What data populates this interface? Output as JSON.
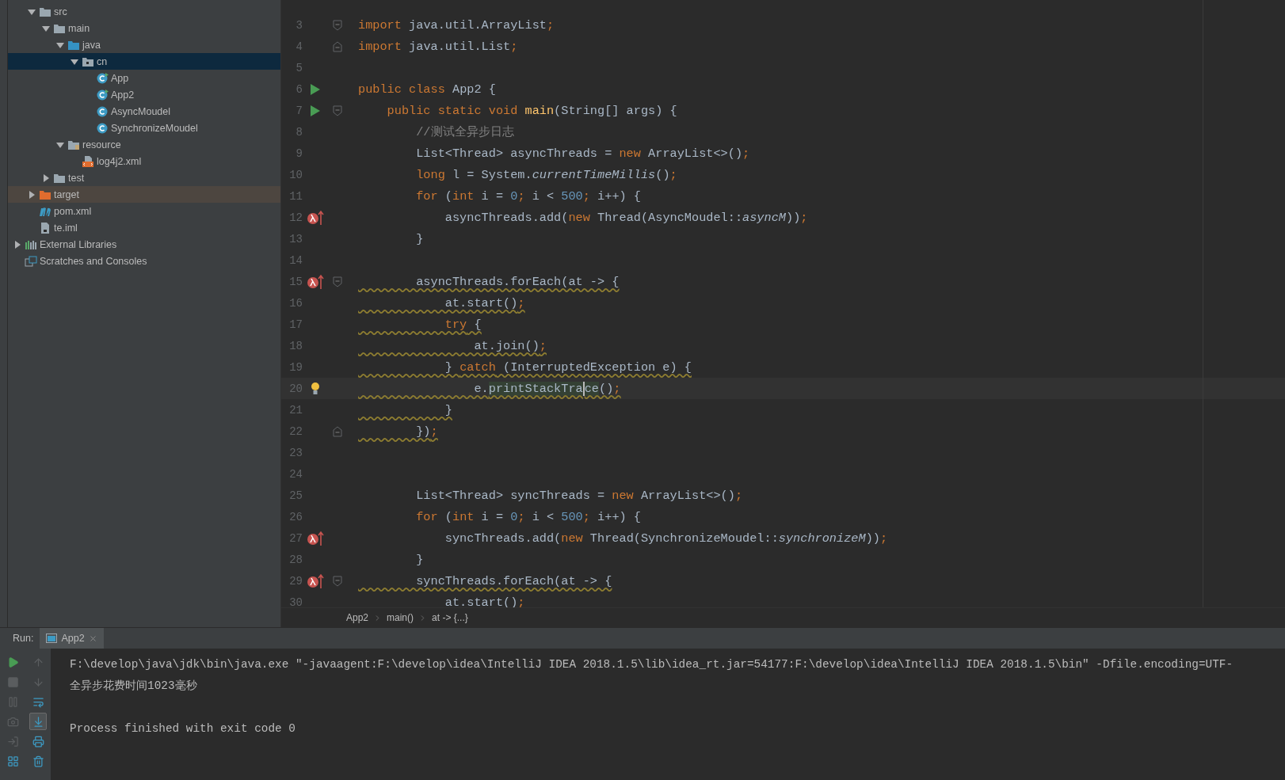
{
  "project_tree": {
    "items": [
      {
        "label": "src",
        "kind": "folder",
        "expanded": true,
        "selected": false,
        "children": [
          {
            "label": "main",
            "kind": "folder",
            "expanded": true,
            "selected": false,
            "children": [
              {
                "label": "java",
                "kind": "source-folder",
                "expanded": true,
                "selected": false,
                "children": [
                  {
                    "label": "cn",
                    "kind": "package",
                    "expanded": true,
                    "selected": true,
                    "children": [
                      {
                        "label": "App",
                        "kind": "run-class",
                        "selected": false
                      },
                      {
                        "label": "App2",
                        "kind": "run-class",
                        "selected": false
                      },
                      {
                        "label": "AsyncMoudel",
                        "kind": "class",
                        "selected": false
                      },
                      {
                        "label": "SynchronizeMoudel",
                        "kind": "class",
                        "selected": false
                      }
                    ]
                  }
                ]
              },
              {
                "label": "resource",
                "kind": "resource-folder",
                "expanded": true,
                "selected": false,
                "children": [
                  {
                    "label": "log4j2.xml",
                    "kind": "xml",
                    "selected": false
                  }
                ]
              }
            ]
          },
          {
            "label": "test",
            "kind": "folder",
            "expanded": false,
            "selected": false
          }
        ]
      },
      {
        "label": "target",
        "kind": "excluded-folder",
        "expanded": false,
        "selected": false,
        "hovered": true
      },
      {
        "label": "pom.xml",
        "kind": "maven",
        "selected": false
      },
      {
        "label": "te.iml",
        "kind": "iml",
        "selected": false
      }
    ],
    "roots": [
      {
        "label": "External Libraries",
        "kind": "libraries",
        "expanded": false,
        "selected": false
      },
      {
        "label": "Scratches and Consoles",
        "kind": "scratches",
        "selected": false
      }
    ]
  },
  "editor": {
    "lines": [
      {
        "number": "3",
        "fold": {
          "kind": "open"
        },
        "tokens": [
          {
            "kind": "kw",
            "text": "import"
          },
          {
            "kind": "plain",
            "text": " java.util.ArrayList"
          },
          {
            "kind": "semi",
            "text": ";"
          }
        ]
      },
      {
        "number": "4",
        "fold": {
          "kind": "close"
        },
        "tokens": [
          {
            "kind": "kw",
            "text": "import"
          },
          {
            "kind": "plain",
            "text": " java.util.List"
          },
          {
            "kind": "semi",
            "text": ";"
          }
        ]
      },
      {
        "number": "5"
      },
      {
        "number": "6",
        "gutter": {
          "kind": "run"
        },
        "tokens": [
          {
            "kind": "kw",
            "text": "public class"
          },
          {
            "kind": "plain",
            "text": " App2 {"
          }
        ]
      },
      {
        "number": "7",
        "gutter": {
          "kind": "run"
        },
        "fold": {
          "kind": "open"
        },
        "tokens": [
          {
            "kind": "kw",
            "text": "    public static void "
          },
          {
            "kind": "decl",
            "text": "main"
          },
          {
            "kind": "plain",
            "text": "(String[] args) {"
          }
        ]
      },
      {
        "number": "8",
        "tokens": [
          {
            "kind": "comment",
            "text": "        //测试全异步日志"
          }
        ]
      },
      {
        "number": "9",
        "tokens": [
          {
            "kind": "plain",
            "text": "        List<Thread> asyncThreads = "
          },
          {
            "kind": "kw",
            "text": "new"
          },
          {
            "kind": "plain",
            "text": " ArrayList<>()"
          },
          {
            "kind": "semi",
            "text": ";"
          }
        ]
      },
      {
        "number": "10",
        "tokens": [
          {
            "kind": "kw",
            "text": "        long"
          },
          {
            "kind": "plain",
            "text": " l = System."
          },
          {
            "kind": "italic",
            "text": "currentTimeMillis"
          },
          {
            "kind": "plain",
            "text": "()"
          },
          {
            "kind": "semi",
            "text": ";"
          }
        ]
      },
      {
        "number": "11",
        "tokens": [
          {
            "kind": "kw",
            "text": "        for"
          },
          {
            "kind": "plain",
            "text": " ("
          },
          {
            "kind": "kw",
            "text": "int"
          },
          {
            "kind": "plain",
            "text": " i = "
          },
          {
            "kind": "num",
            "text": "0"
          },
          {
            "kind": "semi",
            "text": ";"
          },
          {
            "kind": "plain",
            "text": " i < "
          },
          {
            "kind": "num",
            "text": "500"
          },
          {
            "kind": "semi",
            "text": ";"
          },
          {
            "kind": "plain",
            "text": " i++) {"
          }
        ]
      },
      {
        "number": "12",
        "gutter": {
          "kind": "lambda"
        },
        "tokens": [
          {
            "kind": "plain",
            "text": "            asyncThreads.add("
          },
          {
            "kind": "kw",
            "text": "new"
          },
          {
            "kind": "plain",
            "text": " Thread(AsyncMoudel::"
          },
          {
            "kind": "italic",
            "text": "asyncM"
          },
          {
            "kind": "plain",
            "text": "))"
          },
          {
            "kind": "semi",
            "text": ";"
          }
        ]
      },
      {
        "number": "13",
        "tokens": [
          {
            "kind": "plain",
            "text": "        }"
          }
        ]
      },
      {
        "number": "14"
      },
      {
        "number": "15",
        "gutter": {
          "kind": "lambda"
        },
        "fold": {
          "kind": "open"
        },
        "warning": true,
        "tokens": [
          {
            "kind": "plain",
            "text": "        asyncThreads.forEach(at -> {"
          }
        ]
      },
      {
        "number": "16",
        "warning": true,
        "tokens": [
          {
            "kind": "plain",
            "text": "            at.start()"
          },
          {
            "kind": "semi",
            "text": ";"
          }
        ]
      },
      {
        "number": "17",
        "warning": true,
        "tokens": [
          {
            "kind": "kw",
            "text": "            try"
          },
          {
            "kind": "plain",
            "text": " {"
          }
        ]
      },
      {
        "number": "18",
        "warning": true,
        "tokens": [
          {
            "kind": "plain",
            "text": "                at.join()"
          },
          {
            "kind": "semi",
            "text": ";"
          }
        ]
      },
      {
        "number": "19",
        "warning": true,
        "tokens": [
          {
            "kind": "plain",
            "text": "            } "
          },
          {
            "kind": "kw",
            "text": "catch"
          },
          {
            "kind": "plain",
            "text": " (InterruptedException e) {"
          }
        ]
      },
      {
        "number": "20",
        "gutter": {
          "kind": "bulb"
        },
        "warning": true,
        "current": true,
        "tokens": [
          {
            "kind": "plain",
            "text": "                e."
          },
          {
            "kind": "hl",
            "text": "printStackTra",
            "caret": true
          },
          {
            "kind": "hl",
            "text": "ce"
          },
          {
            "kind": "plain",
            "text": "()"
          },
          {
            "kind": "semi",
            "text": ";"
          }
        ]
      },
      {
        "number": "21",
        "warning": true,
        "tokens": [
          {
            "kind": "plain",
            "text": "            }"
          }
        ]
      },
      {
        "number": "22",
        "fold": {
          "kind": "close"
        },
        "warning": true,
        "tokens": [
          {
            "kind": "plain",
            "text": "        })"
          },
          {
            "kind": "semi",
            "text": ";"
          }
        ]
      },
      {
        "number": "23"
      },
      {
        "number": "24"
      },
      {
        "number": "25",
        "tokens": [
          {
            "kind": "plain",
            "text": "        List<Thread> syncThreads = "
          },
          {
            "kind": "kw",
            "text": "new"
          },
          {
            "kind": "plain",
            "text": " ArrayList<>()"
          },
          {
            "kind": "semi",
            "text": ";"
          }
        ]
      },
      {
        "number": "26",
        "tokens": [
          {
            "kind": "kw",
            "text": "        for"
          },
          {
            "kind": "plain",
            "text": " ("
          },
          {
            "kind": "kw",
            "text": "int"
          },
          {
            "kind": "plain",
            "text": " i = "
          },
          {
            "kind": "num",
            "text": "0"
          },
          {
            "kind": "semi",
            "text": ";"
          },
          {
            "kind": "plain",
            "text": " i < "
          },
          {
            "kind": "num",
            "text": "500"
          },
          {
            "kind": "semi",
            "text": ";"
          },
          {
            "kind": "plain",
            "text": " i++) {"
          }
        ]
      },
      {
        "number": "27",
        "gutter": {
          "kind": "lambda"
        },
        "tokens": [
          {
            "kind": "plain",
            "text": "            syncThreads.add("
          },
          {
            "kind": "kw",
            "text": "new"
          },
          {
            "kind": "plain",
            "text": " Thread(SynchronizeMoudel::"
          },
          {
            "kind": "italic",
            "text": "synchronizeM"
          },
          {
            "kind": "plain",
            "text": "))"
          },
          {
            "kind": "semi",
            "text": ";"
          }
        ]
      },
      {
        "number": "28",
        "tokens": [
          {
            "kind": "plain",
            "text": "        }"
          }
        ]
      },
      {
        "number": "29",
        "gutter": {
          "kind": "lambda"
        },
        "fold": {
          "kind": "open"
        },
        "warning": true,
        "tokens": [
          {
            "kind": "plain",
            "text": "        syncThreads.forEach(at -> {"
          }
        ]
      },
      {
        "number": "30",
        "tokens": [
          {
            "kind": "plain",
            "text": "            at.start()"
          },
          {
            "kind": "semi",
            "text": ";"
          }
        ]
      }
    ],
    "breadcrumbs": [
      "App2",
      "main()",
      "at -> {...}"
    ]
  },
  "run": {
    "label": "Run:",
    "tab": {
      "label": "App2",
      "selected": true
    },
    "toolbar_left": [
      {
        "kind": "run",
        "disabled": false
      },
      {
        "kind": "stop",
        "disabled": true
      },
      {
        "kind": "pause",
        "disabled": true
      },
      {
        "kind": "dump",
        "disabled": true
      },
      {
        "kind": "exit",
        "disabled": true
      },
      {
        "kind": "layout",
        "disabled": false
      }
    ],
    "toolbar_right": [
      {
        "kind": "up",
        "disabled": true,
        "selected": false
      },
      {
        "kind": "down",
        "disabled": true,
        "selected": false
      },
      {
        "kind": "wrap",
        "disabled": false,
        "selected": false
      },
      {
        "kind": "scroll-end",
        "disabled": false,
        "selected": true
      },
      {
        "kind": "print",
        "disabled": false,
        "selected": false
      },
      {
        "kind": "trash",
        "disabled": false,
        "selected": false
      }
    ],
    "console": [
      {
        "kind": "command",
        "text": "F:\\develop\\java\\jdk\\bin\\java.exe \"-javaagent:F:\\develop\\idea\\IntelliJ IDEA 2018.1.5\\lib\\idea_rt.jar=54177:F:\\develop\\idea\\IntelliJ IDEA 2018.1.5\\bin\" -Dfile.encoding=UTF-"
      },
      {
        "kind": "output",
        "text": "全异步花费时间1023毫秒"
      },
      {
        "kind": "exit",
        "text": "Process finished with exit code 0"
      }
    ]
  }
}
